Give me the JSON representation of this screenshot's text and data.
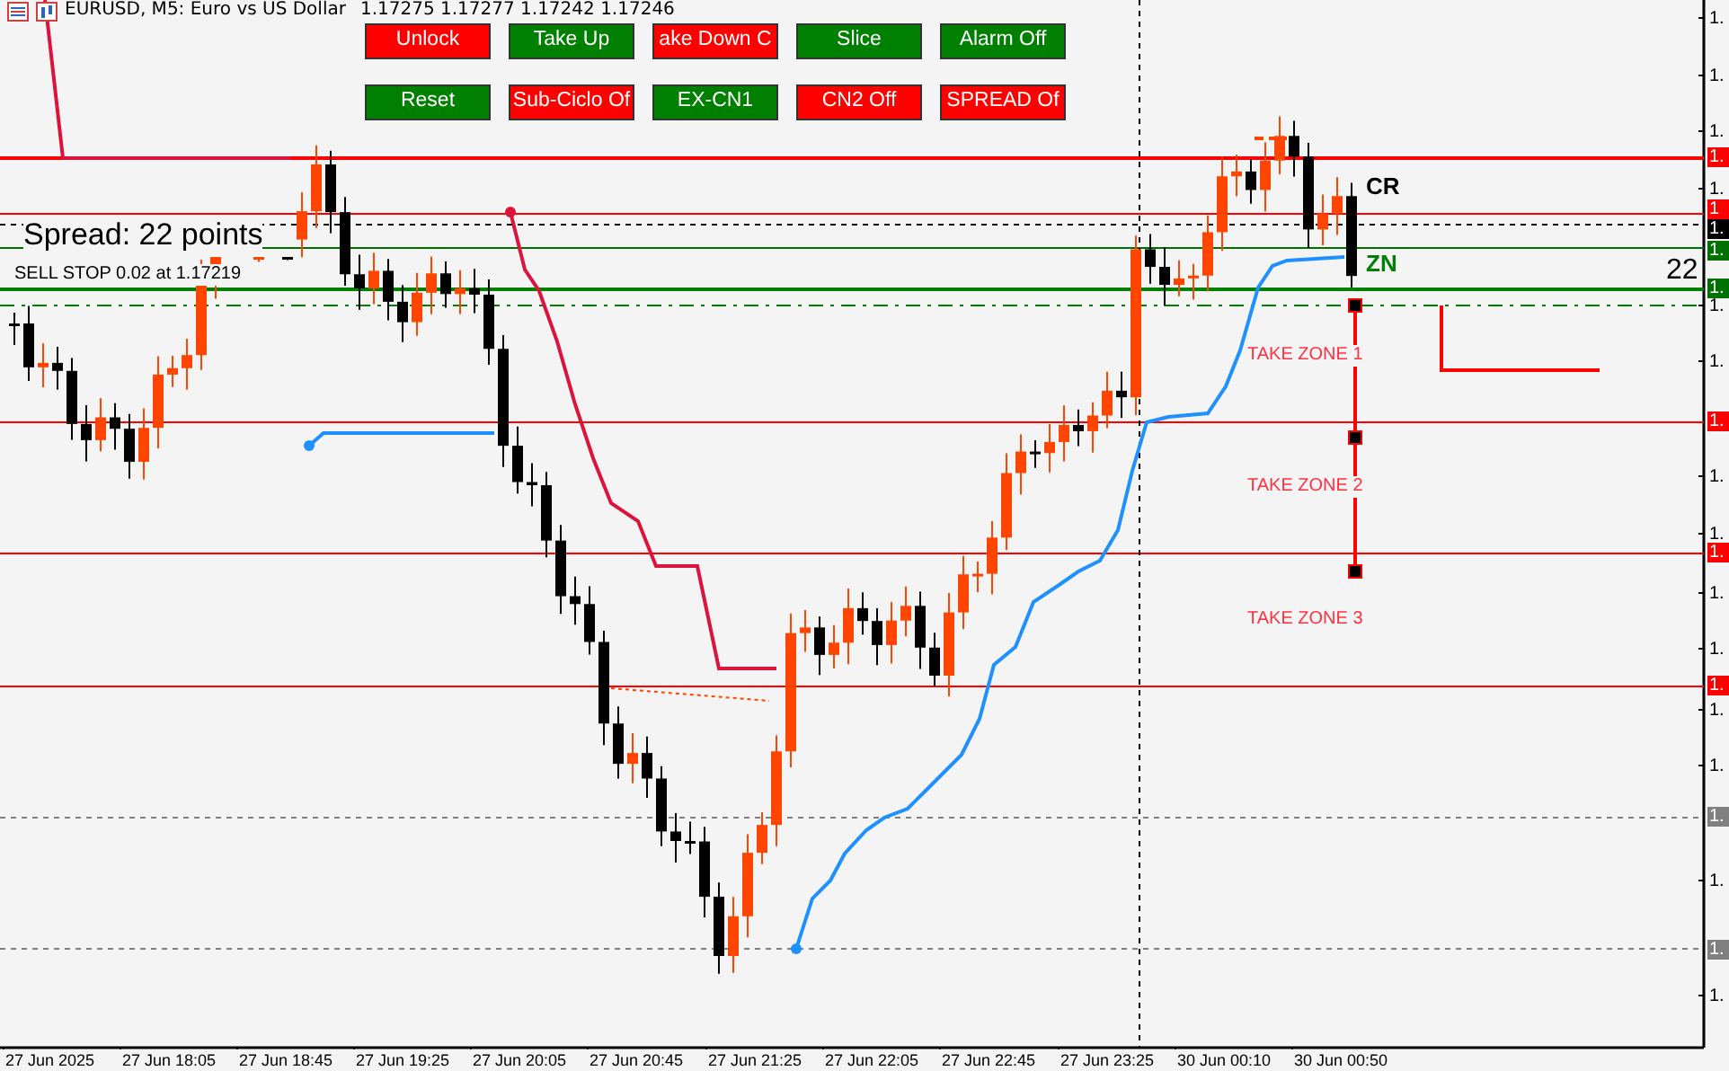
{
  "chart": {
    "title": "EURUSD, M5:  Euro vs US Dollar",
    "prices": "1.17275 1.17277 1.17242 1.17246"
  },
  "buttons": [
    {
      "label": "Unlock",
      "color": "#ff0000"
    },
    {
      "label": "Take Up",
      "color": "#008000"
    },
    {
      "label": "ake Down C",
      "color": "#ff0000"
    },
    {
      "label": "Slice",
      "color": "#008000"
    },
    {
      "label": "Alarm Off",
      "color": "#008000"
    },
    {
      "label": "Reset",
      "color": "#008000"
    },
    {
      "label": "Sub-Ciclo Of",
      "color": "#ff0000"
    },
    {
      "label": "EX-CN1",
      "color": "#008000"
    },
    {
      "label": "CN2 Off",
      "color": "#ff0000"
    },
    {
      "label": "SPREAD Of",
      "color": "#ff0000"
    }
  ],
  "spread_label": "Spread: 22 points",
  "order_label": "SELL STOP 0.02 at 1.17219",
  "spread_value": "22",
  "markers": [
    {
      "text": "CR",
      "color": "#000000"
    },
    {
      "text": "ZN",
      "color": "#008000"
    }
  ],
  "zones": [
    "TAKE ZONE 1",
    "TAKE ZONE 2",
    "TAKE ZONE 3"
  ],
  "price_axis": {
    "ticks": [
      "1.",
      "1.",
      "1.",
      "1.",
      "1.",
      "1.",
      "1.",
      "1.",
      "1.",
      "1.",
      "1.",
      "1.",
      "1.",
      "1."
    ],
    "tags": [
      {
        "text": "1.",
        "color": "#ff0000"
      },
      {
        "text": "1",
        "color": "#ff0000"
      },
      {
        "text": "1.",
        "color": "#000000"
      },
      {
        "text": "1.",
        "color": "#007000"
      },
      {
        "text": "1.",
        "color": "#007000"
      },
      {
        "text": "1.",
        "color": "#ff0000"
      },
      {
        "text": "1.",
        "color": "#ff0000"
      },
      {
        "text": "1.",
        "color": "#ff0000"
      },
      {
        "text": "1.",
        "color": "#808080"
      },
      {
        "text": "1.",
        "color": "#808080"
      }
    ]
  },
  "time_axis": [
    "27 Jun 2025",
    "27 Jun 18:05",
    "27 Jun 18:45",
    "27 Jun 19:25",
    "27 Jun 20:05",
    "27 Jun 20:45",
    "27 Jun 21:25",
    "27 Jun 22:05",
    "27 Jun 22:45",
    "27 Jun 23:25",
    "30 Jun 00:10",
    "30 Jun 00:50"
  ]
}
